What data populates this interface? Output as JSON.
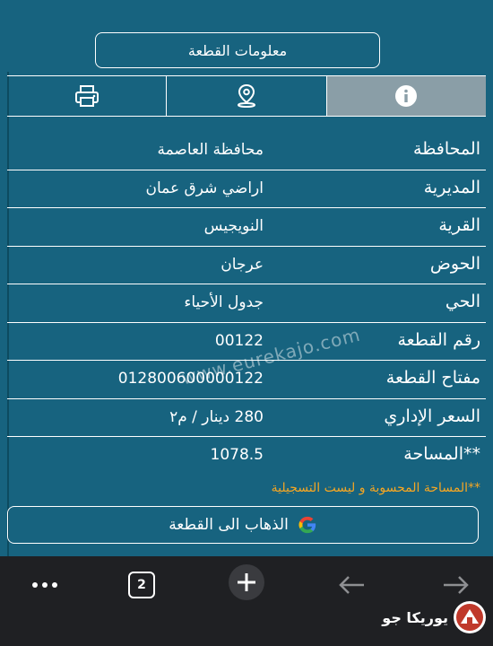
{
  "header": {
    "title": "معلومات القطعة"
  },
  "tabs": [
    {
      "icon": "print-icon",
      "active": false
    },
    {
      "icon": "location-pin-icon",
      "active": false
    },
    {
      "icon": "info-icon",
      "active": true
    }
  ],
  "rows": [
    {
      "label": "المحافظة",
      "value": "محافظة العاصمة"
    },
    {
      "label": "المديرية",
      "value": "اراضي شرق عمان"
    },
    {
      "label": "القرية",
      "value": "النويجيس"
    },
    {
      "label": "الحوض",
      "value": "عرجان"
    },
    {
      "label": "الحي",
      "value": "جدول الأحياء"
    },
    {
      "label": "رقم القطعة",
      "value": "00122"
    },
    {
      "label": "مفتاح القطعة",
      "value": "012800600000122"
    },
    {
      "label": "السعر الإداري",
      "value": "280 دينار / م٢"
    },
    {
      "label": "**المساحة",
      "value": "1078.5"
    }
  ],
  "note": "**المساحة المحسوبة و ليست التسجيلية",
  "goto_button": {
    "label": "الذهاب الى القطعة"
  },
  "watermark": "www.eurekajo.com",
  "browser": {
    "tab_count": "2"
  },
  "logo": {
    "text": "يوريكا جو"
  },
  "colors": {
    "background": "#17637f",
    "active_tab": "#8a9ea7",
    "note": "#f5a623",
    "browser_bar": "#1f2023"
  }
}
